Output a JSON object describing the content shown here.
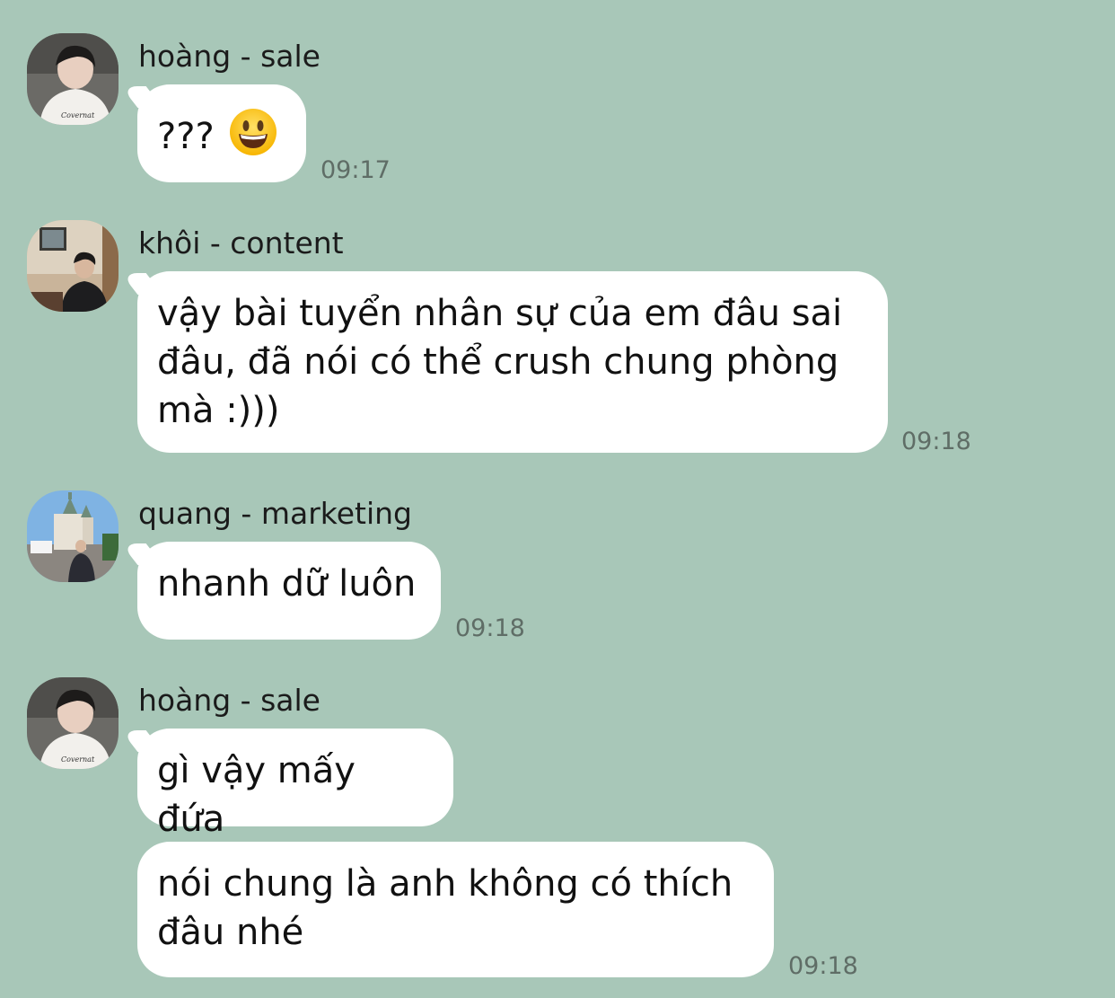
{
  "messages": [
    {
      "sender": "hoàng - sale",
      "text": "???",
      "emoji": "grinning-face",
      "time": "09:17"
    },
    {
      "sender": "khôi - content",
      "text": "vậy bài tuyển nhân sự của em đâu sai\nđâu, đã nói có thể crush chung phòng\nmà :)))",
      "time": "09:18"
    },
    {
      "sender": "quang - marketing",
      "text": "nhanh dữ luôn",
      "time": "09:18"
    },
    {
      "sender": "hoàng - sale",
      "text": "gì vậy mấy đứa"
    },
    {
      "text": "nói chung là anh không có thích\nđâu nhé",
      "time": "09:18"
    }
  ],
  "colors": {
    "background": "#a8c7b8",
    "bubble": "#ffffff",
    "time": "#5f6d66"
  }
}
